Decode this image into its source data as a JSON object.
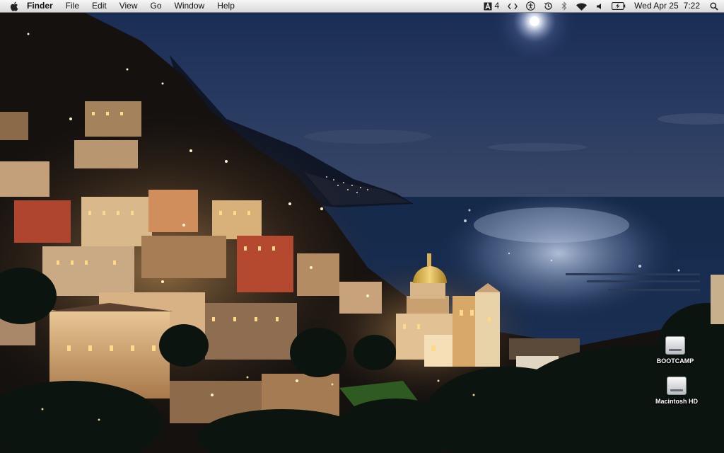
{
  "menubar": {
    "apple_icon": "apple-logo-icon",
    "app_name": "Finder",
    "menus": [
      "File",
      "Edit",
      "View",
      "Go",
      "Window",
      "Help"
    ],
    "status": {
      "adobe_count": "4",
      "date": "Wed Apr 25",
      "time": "7:22"
    }
  },
  "desktop": {
    "icons": [
      {
        "label": "BOOTCAMP",
        "icon": "hard-drive-icon"
      },
      {
        "label": "Macintosh HD",
        "icon": "hard-drive-icon"
      }
    ]
  },
  "colors": {
    "menubar_top": "#f7f7f7",
    "menubar_bottom": "#d9d9d9",
    "sky": "#1b2d52",
    "sea": "#132744"
  }
}
